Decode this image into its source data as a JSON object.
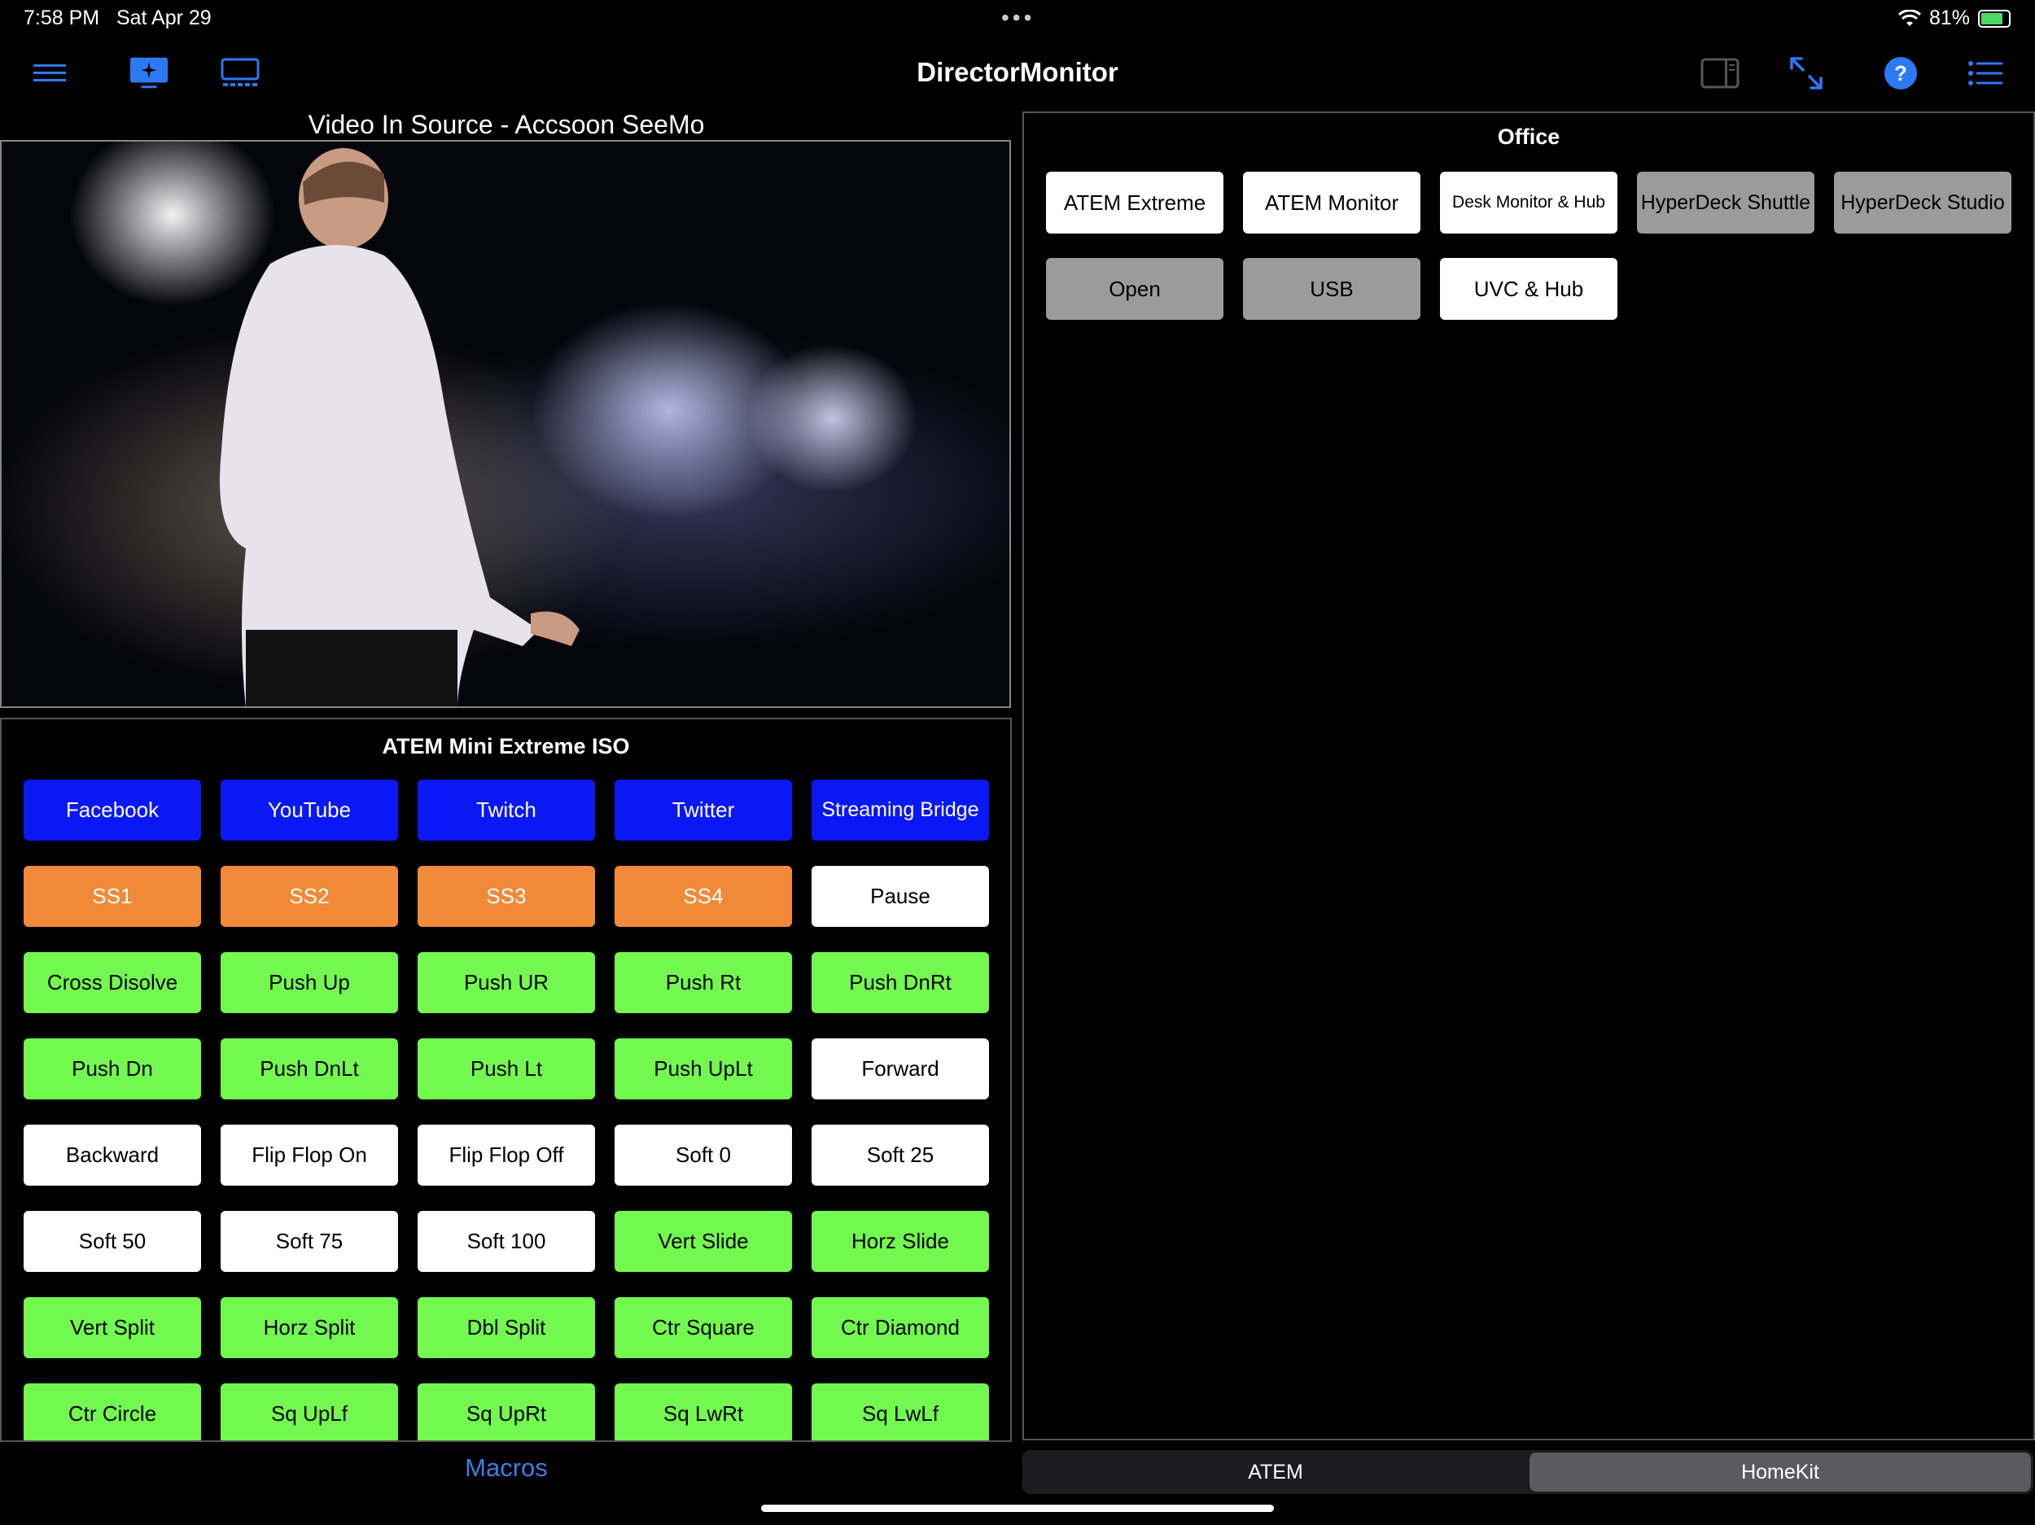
{
  "status_bar": {
    "time": "7:58 PM",
    "date": "Sat Apr 29",
    "dots": "•••",
    "battery": "81%",
    "battery_level": 0.81
  },
  "nav": {
    "title": "DirectorMonitor",
    "left_icons": [
      "menu-icon",
      "monitor-sparkle-icon",
      "display-dock-icon"
    ],
    "right_icons": [
      "sidebar-icon",
      "expand-arrows-icon",
      "help-icon",
      "list-icon"
    ],
    "accent": "#2d79f3"
  },
  "video": {
    "title": "Video In Source - Accsoon SeeMo"
  },
  "macros": {
    "title": "ATEM Mini Extreme ISO",
    "tab_label": "Macros",
    "buttons": [
      {
        "label": "Facebook",
        "color": "blue"
      },
      {
        "label": "YouTube",
        "color": "blue"
      },
      {
        "label": "Twitch",
        "color": "blue"
      },
      {
        "label": "Twitter",
        "color": "blue"
      },
      {
        "label": "Streaming Bridge",
        "color": "blue"
      },
      {
        "label": "SS1",
        "color": "orange"
      },
      {
        "label": "SS2",
        "color": "orange"
      },
      {
        "label": "SS3",
        "color": "orange"
      },
      {
        "label": "SS4",
        "color": "orange"
      },
      {
        "label": "Pause",
        "color": "white"
      },
      {
        "label": "Cross Disolve",
        "color": "green"
      },
      {
        "label": "Push Up",
        "color": "green"
      },
      {
        "label": "Push UR",
        "color": "green"
      },
      {
        "label": "Push Rt",
        "color": "green"
      },
      {
        "label": "Push DnRt",
        "color": "green"
      },
      {
        "label": "Push Dn",
        "color": "green"
      },
      {
        "label": "Push DnLt",
        "color": "green"
      },
      {
        "label": "Push Lt",
        "color": "green"
      },
      {
        "label": "Push UpLt",
        "color": "green"
      },
      {
        "label": "Forward",
        "color": "white"
      },
      {
        "label": "Backward",
        "color": "white"
      },
      {
        "label": "Flip Flop On",
        "color": "white"
      },
      {
        "label": "Flip Flop Off",
        "color": "white"
      },
      {
        "label": "Soft 0",
        "color": "white"
      },
      {
        "label": "Soft 25",
        "color": "white"
      },
      {
        "label": "Soft 50",
        "color": "white"
      },
      {
        "label": "Soft 75",
        "color": "white"
      },
      {
        "label": "Soft 100",
        "color": "white"
      },
      {
        "label": "Vert Slide",
        "color": "green"
      },
      {
        "label": "Horz Slide",
        "color": "green"
      },
      {
        "label": "Vert Split",
        "color": "green"
      },
      {
        "label": "Horz Split",
        "color": "green"
      },
      {
        "label": "Dbl Split",
        "color": "green"
      },
      {
        "label": "Ctr Square",
        "color": "green"
      },
      {
        "label": "Ctr Diamond",
        "color": "green"
      },
      {
        "label": "Ctr Circle",
        "color": "green"
      },
      {
        "label": "Sq UpLf",
        "color": "green"
      },
      {
        "label": "Sq UpRt",
        "color": "green"
      },
      {
        "label": "Sq LwRt",
        "color": "green"
      },
      {
        "label": "Sq LwLf",
        "color": "green"
      }
    ]
  },
  "office": {
    "title": "Office",
    "buttons": [
      {
        "label": "ATEM Extreme",
        "color": "white"
      },
      {
        "label": "ATEM Monitor",
        "color": "white"
      },
      {
        "label": "Desk Monitor & Hub",
        "color": "white",
        "small": true
      },
      {
        "label": "HyperDeck Shuttle",
        "color": "gray"
      },
      {
        "label": "HyperDeck Studio",
        "color": "gray"
      },
      {
        "label": "Open",
        "color": "gray"
      },
      {
        "label": "USB",
        "color": "gray"
      },
      {
        "label": "UVC & Hub",
        "color": "white"
      }
    ]
  },
  "segmented": {
    "tabs": [
      "ATEM",
      "HomeKit"
    ],
    "selected": 1
  },
  "colors": {
    "blue": "#0a18f6",
    "orange": "#f08a38",
    "green": "#72f84f",
    "white": "#ffffff",
    "gray": "#9b9b9b"
  }
}
